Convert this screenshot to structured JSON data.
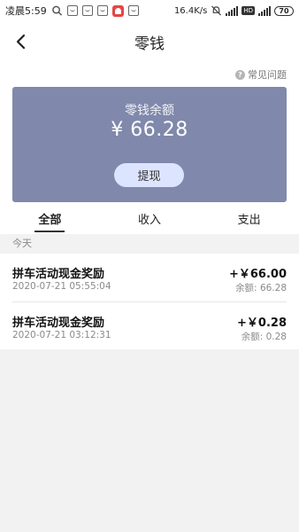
{
  "statusbar": {
    "time": "凌晨5:59",
    "speed": "16.4K/s",
    "battery": "70"
  },
  "header": {
    "title": "零钱"
  },
  "faq": {
    "label": "常见问题"
  },
  "balance": {
    "label": "零钱余额",
    "amount": "¥ 66.28",
    "withdraw_label": "提现"
  },
  "tabs": [
    {
      "label": "全部",
      "active": true
    },
    {
      "label": "收入",
      "active": false
    },
    {
      "label": "支出",
      "active": false
    }
  ],
  "section": {
    "label": "今天"
  },
  "transactions": [
    {
      "title": "拼车活动现金奖励",
      "time": "2020-07-21 05:55:04",
      "amount": "+￥66.00",
      "balance": "余额:  66.28"
    },
    {
      "title": "拼车活动现金奖励",
      "time": "2020-07-21 03:12:31",
      "amount": "+￥0.28",
      "balance": "余额:  0.28"
    }
  ],
  "colors": {
    "card": "#8088ab",
    "button": "#dde4ff",
    "page_bg": "#f2f2f2"
  }
}
